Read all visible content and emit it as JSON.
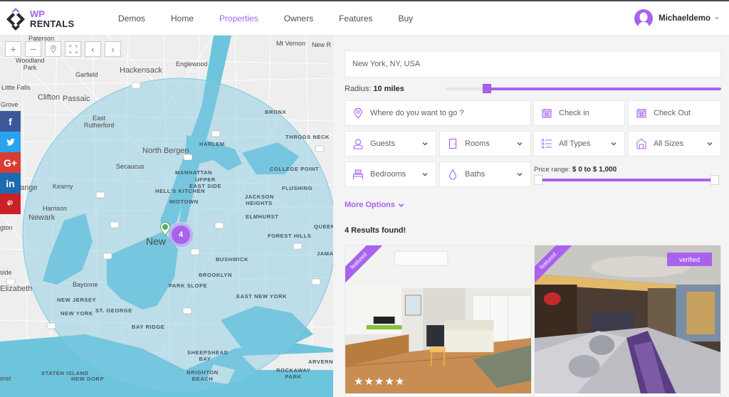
{
  "brand": {
    "line1": "WP",
    "line2": "RENTALS",
    "accent": "#a862ee"
  },
  "nav": {
    "items": [
      {
        "label": "Demos",
        "active": false
      },
      {
        "label": "Home",
        "active": false
      },
      {
        "label": "Properties",
        "active": true
      },
      {
        "label": "Owners",
        "active": false
      },
      {
        "label": "Features",
        "active": false
      },
      {
        "label": "Buy",
        "active": false
      }
    ]
  },
  "user": {
    "name": "Michaeldemo",
    "icon": "user-avatar-icon"
  },
  "map": {
    "controls": [
      {
        "name": "zoom-in-button",
        "icon": "plus-icon",
        "glyph": "+"
      },
      {
        "name": "zoom-out-button",
        "icon": "minus-icon",
        "glyph": "−"
      },
      {
        "name": "my-location-button",
        "icon": "location-pin-icon",
        "glyph": ""
      },
      {
        "name": "fullscreen-button",
        "icon": "fullscreen-icon",
        "glyph": ""
      },
      {
        "name": "prev-button",
        "icon": "chevron-left-icon",
        "glyph": "‹"
      },
      {
        "name": "next-button",
        "icon": "chevron-right-icon",
        "glyph": "›"
      }
    ],
    "social": [
      {
        "name": "facebook",
        "glyph": "f",
        "color": "#3b5998"
      },
      {
        "name": "twitter",
        "glyph": "🐦",
        "color": "#1da1f2"
      },
      {
        "name": "google-plus",
        "glyph": "G+",
        "color": "#dd4b39"
      },
      {
        "name": "linkedin",
        "glyph": "in",
        "color": "#0e76a8"
      },
      {
        "name": "pinterest",
        "glyph": "P",
        "color": "#cb2027"
      }
    ],
    "cluster_count": "4",
    "labels": {
      "paterson": "Paterson",
      "woodland_park": "Woodland Park",
      "garfield": "Garfield",
      "hackensack": "Hackensack",
      "englewood": "Englewood",
      "mt_vernon": "Mt Vernon",
      "new_r": "New R",
      "little_falls": "Little Falls",
      "clifton": "Clifton",
      "passaic": "Passaic",
      "grove": "Grove",
      "east_rutherford": "East Rutherford",
      "bronx": "BRONX",
      "throgs_neck": "THROGS NECK",
      "harlem": "HARLEM",
      "north_bergen": "North Bergen",
      "secaucus": "Secaucus",
      "manhattan": "MANHATTAN",
      "upper_east_side": "UPPER EAST SIDE",
      "college_point": "COLLEGE POINT",
      "hells_kitchen": "HELL'S KITCHEN",
      "flushing": "FLUSHING",
      "midtown": "MIDTOWN",
      "kearny": "Kearny",
      "ange": "ange",
      "jackson_heights": "JACKSON HEIGHTS",
      "harrison": "Harrison",
      "elmhurst": "ELMHURST",
      "newark": "Newark",
      "gton": "gton",
      "new": "New",
      "forest_hills": "FOREST HILLS",
      "queens": "QUEENS",
      "bushwick": "BUSHWICK",
      "jamaica": "JAMAI",
      "brooklyn": "BROOKLYN",
      "bayonne": "Bayonne",
      "elizabeth": "Elizabeth",
      "park_slope": "PARK SLOPE",
      "new_jersey": "NEW JERSEY",
      "new_york": "NEW YORK",
      "st_george": "ST. GEORGE",
      "east_new_york": "EAST NEW YORK",
      "bay_ridge": "BAY RIDGE",
      "sheepshead_bay": "SHEEPSHEAD BAY",
      "staten_island": "STATEN ISLAND",
      "new_dorp": "NEW DORP",
      "brighton_beach": "BRIGHTON BEACH",
      "rockaway_park": "ROCKAWAY PARK",
      "arverne": "ARVERNE",
      "side": "side",
      "eret": "eret"
    }
  },
  "search": {
    "location_value": "New York, NY, USA",
    "radius": {
      "label": "Radius:",
      "value": "10 miles",
      "fraction": 0.15
    },
    "where": {
      "placeholder": "Where do you want to go ?",
      "icon": "location-pin-icon"
    },
    "check_in": {
      "label": "Check in",
      "icon": "calendar-icon"
    },
    "check_out": {
      "label": "Check Out",
      "icon": "calendar-icon"
    },
    "guests": {
      "label": "Guests",
      "icon": "user-icon"
    },
    "rooms": {
      "label": "Rooms",
      "icon": "door-icon"
    },
    "types": {
      "label": "All Types",
      "icon": "list-icon"
    },
    "sizes": {
      "label": "All Sizes",
      "icon": "house-icon"
    },
    "bedrooms": {
      "label": "Bedrooms",
      "icon": "bed-icon"
    },
    "baths": {
      "label": "Baths",
      "icon": "drop-icon"
    },
    "price": {
      "label": "Price range:",
      "value": "$ 0 to $ 1,000",
      "min": 0,
      "max": 1000
    },
    "more_options": "More Options"
  },
  "results": {
    "count_text": "4 Results found!",
    "cards": [
      {
        "ribbon": "featured",
        "badge": "",
        "stars": 5
      },
      {
        "ribbon": "featured",
        "badge": "verified",
        "stars": 0
      }
    ]
  }
}
